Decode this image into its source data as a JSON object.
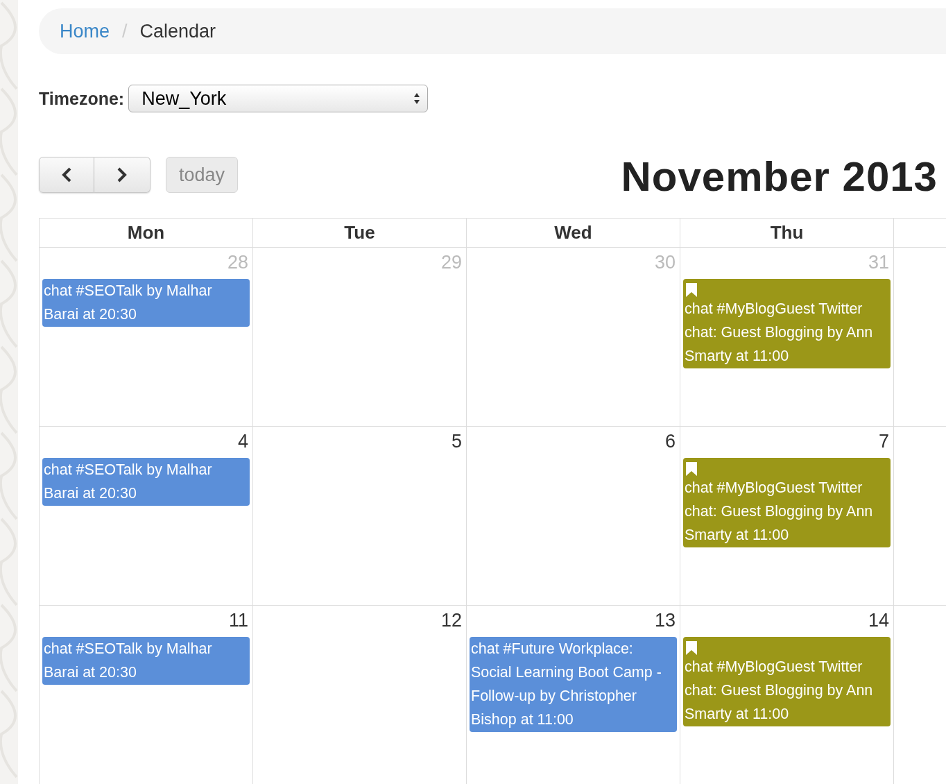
{
  "breadcrumb": {
    "separator": "/",
    "items": [
      {
        "label": "Home",
        "link": true
      },
      {
        "label": "Calendar",
        "link": false
      }
    ]
  },
  "timezone": {
    "label": "Timezone:",
    "value": "New_York"
  },
  "toolbar": {
    "today": {
      "label": "today",
      "disabled": true
    },
    "title": "November 2013"
  },
  "calendar": {
    "columns": [
      "Mon",
      "Tue",
      "Wed",
      "Thu"
    ],
    "weeks": [
      {
        "days": [
          {
            "number": "28",
            "other_month": true,
            "events": [
              {
                "title": "chat #SEOTalk by Malhar Barai at 20:30",
                "color": "#5b8fd9",
                "bookmark": false
              }
            ]
          },
          {
            "number": "29",
            "other_month": true
          },
          {
            "number": "30",
            "other_month": true
          },
          {
            "number": "31",
            "other_month": true,
            "events": [
              {
                "title": "chat #MyBlogGuest Twitter chat: Guest Blogging by Ann Smarty at 11:00",
                "color": "#9b9718",
                "bookmark": true
              }
            ]
          }
        ]
      },
      {
        "days": [
          {
            "number": "4",
            "other_month": false,
            "events": [
              {
                "title": "chat #SEOTalk by Malhar Barai at 20:30",
                "color": "#5b8fd9",
                "bookmark": false
              }
            ]
          },
          {
            "number": "5",
            "other_month": false
          },
          {
            "number": "6",
            "other_month": false
          },
          {
            "number": "7",
            "other_month": false,
            "events": [
              {
                "title": "chat #MyBlogGuest Twitter chat: Guest Blogging by Ann Smarty at 11:00",
                "color": "#9b9718",
                "bookmark": true
              }
            ]
          }
        ]
      },
      {
        "days": [
          {
            "number": "11",
            "other_month": false,
            "events": [
              {
                "title": "chat #SEOTalk by Malhar Barai at 20:30",
                "color": "#5b8fd9",
                "bookmark": false
              }
            ]
          },
          {
            "number": "12",
            "other_month": false
          },
          {
            "number": "13",
            "other_month": false,
            "events": [
              {
                "title": "chat #Future Workplace: Social Learning Boot Camp - Follow-up by Christopher Bishop at 11:00",
                "color": "#5b8fd9",
                "bookmark": false
              }
            ]
          },
          {
            "number": "14",
            "other_month": false,
            "events": [
              {
                "title": "chat #MyBlogGuest Twitter chat: Guest Blogging by Ann Smarty at 11:00",
                "color": "#9b9718",
                "bookmark": true
              }
            ]
          }
        ]
      }
    ]
  }
}
